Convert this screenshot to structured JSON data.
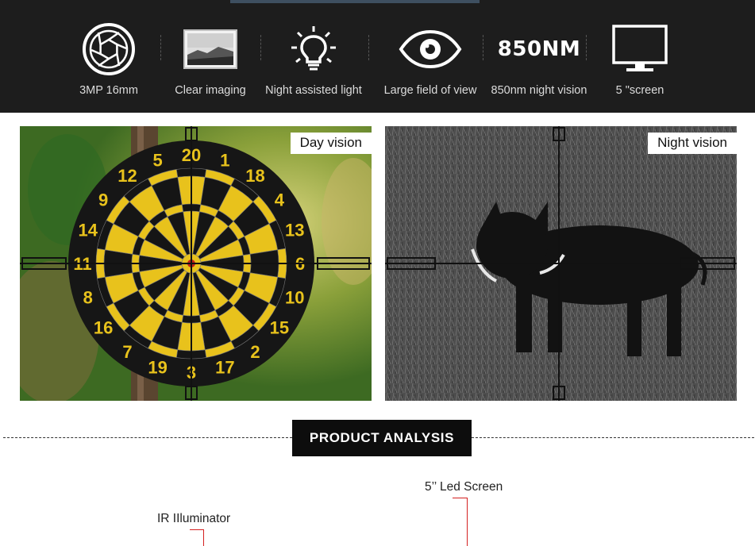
{
  "features": [
    {
      "icon": "aperture-icon",
      "label": "3MP 16mm"
    },
    {
      "icon": "landscape-image-icon",
      "label": "Clear imaging"
    },
    {
      "icon": "lightbulb-icon",
      "label": "Night assisted light"
    },
    {
      "icon": "eye-icon",
      "label": "Large field of view"
    },
    {
      "icon": "850nm-text-icon",
      "label": "850nm night vision",
      "icon_text": "850NM"
    },
    {
      "icon": "monitor-icon",
      "label": "5 \"screen"
    }
  ],
  "panels": {
    "day": {
      "tag": "Day vision"
    },
    "night": {
      "tag": "Night vision"
    }
  },
  "dartboard_numbers": [
    "20",
    "1",
    "18",
    "4",
    "13",
    "6",
    "10",
    "15",
    "2",
    "17",
    "3",
    "19",
    "7",
    "16",
    "8",
    "11",
    "14",
    "9",
    "12",
    "5"
  ],
  "section": {
    "title": "PRODUCT ANALYSIS"
  },
  "callouts": {
    "screen": "5’’ Led Screen",
    "illuminator": "IR IIluminator"
  },
  "colors": {
    "banner_bg": "#1d1d1d",
    "banner_accent": "#3e4f60",
    "dart_yellow": "#e8c21c",
    "dart_black": "#151515",
    "callout_line": "#d42020"
  }
}
